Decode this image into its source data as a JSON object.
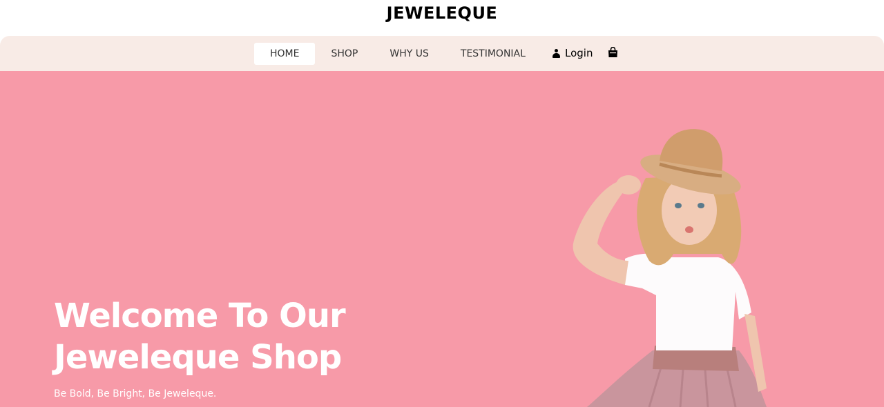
{
  "brand": {
    "name": "JEWELEQUE"
  },
  "nav": {
    "items": [
      {
        "label": "HOME",
        "active": true
      },
      {
        "label": "SHOP",
        "active": false
      },
      {
        "label": "WHY US",
        "active": false
      },
      {
        "label": "TESTIMONIAL",
        "active": false
      }
    ],
    "login_label": "Login",
    "login_icon": "user-icon",
    "cart_icon": "shopping-bag-icon"
  },
  "hero": {
    "title_line1": "Welcome To Our",
    "title_line2": "Jeweleque Shop",
    "subtitle": "Be Bold, Be Bright, Be Jeweleque.",
    "image": "girl-in-straw-hat-photo"
  },
  "colors": {
    "nav_bg": "#f8ebe6",
    "hero_bg": "#f79aa8",
    "text_dark": "#000000",
    "hero_text": "#ffffff"
  }
}
